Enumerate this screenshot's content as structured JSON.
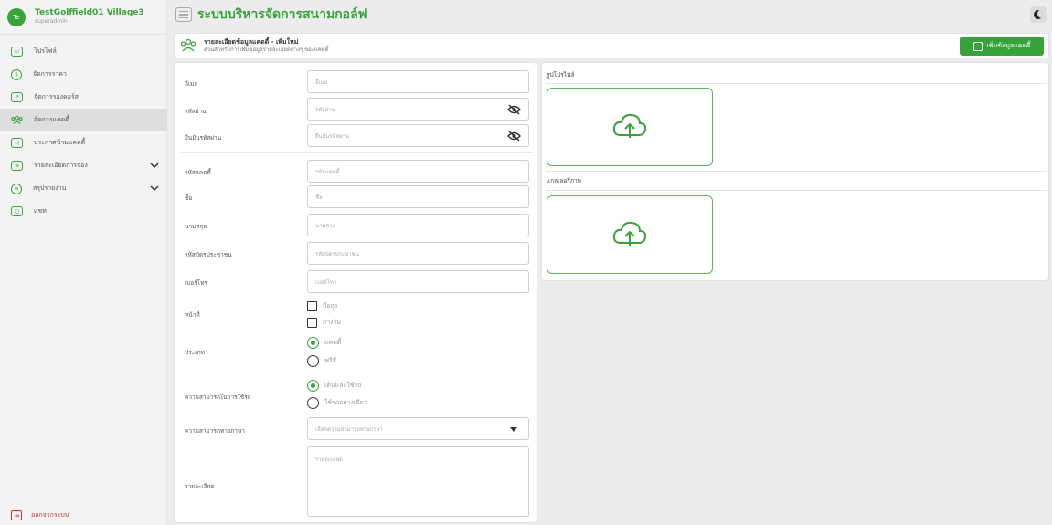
{
  "brand": {
    "avatar_text": "Te",
    "name": "TestGolffield01 Village3",
    "role": "superadmin"
  },
  "app": {
    "title": "ระบบบริหารจัดการสนามกอล์ฟ"
  },
  "sidebar": {
    "items": [
      {
        "label": "โปรไฟล์",
        "icon": "profile-card-icon",
        "active": false
      },
      {
        "label": "จัดการราคา",
        "icon": "money-coin-icon",
        "active": false
      },
      {
        "label": "จัดการรองคอร์ส",
        "icon": "chart-icon",
        "active": false
      },
      {
        "label": "จัดการแคดดี้",
        "icon": "users-group-icon",
        "active": true
      },
      {
        "label": "ประกาศข้ามแคดดี้",
        "icon": "megaphone-icon",
        "active": false
      },
      {
        "label": "รายละเอียดการจอง",
        "icon": "booking-list-icon",
        "active": false,
        "expandable": true
      },
      {
        "label": "สรุปรายงาน",
        "icon": "report-database-icon",
        "active": false,
        "expandable": true
      },
      {
        "label": "แชท",
        "icon": "chat-icon",
        "active": false
      }
    ],
    "logout_label": "ออกจากระบบ"
  },
  "header": {
    "title": "รายละเอียดข้อมูลแคดดี้ - เพิ่มใหม่",
    "subtitle": "ส่วนสำหรับการเพิ่มข้อมูลรายละเอียดต่างๆ ของแคดดี้",
    "add_button": "เพิ่มข้อมูลแคดดี้"
  },
  "form": {
    "email": {
      "label": "อีเมล",
      "placeholder": "อีเมล"
    },
    "password": {
      "label": "รหัสผ่าน",
      "placeholder": "รหัสผ่าน"
    },
    "confirm_password": {
      "label": "ยืนยันรหัสผ่าน",
      "placeholder": "ยืนยันรหัสผ่าน"
    },
    "caddy_code": {
      "label": "รหัสแคดดี้",
      "placeholder": "รหัสแคดดี้"
    },
    "first_name": {
      "label": "ชื่อ",
      "placeholder": "ชื่อ"
    },
    "last_name": {
      "label": "นามสกุล",
      "placeholder": "นามสกุล"
    },
    "id_card": {
      "label": "รหัสบัตรประชาชน",
      "placeholder": "รหัสบัตรประชาชน"
    },
    "phone": {
      "label": "เบอร์โทร",
      "placeholder": "เบอร์โทร"
    },
    "duty": {
      "label": "หน้าที่",
      "options": [
        "ถือถุง",
        "กางร่ม"
      ]
    },
    "type": {
      "label": "ประเภท",
      "options": [
        "แคดดี้",
        "ฟรีสี่"
      ],
      "selected": 0
    },
    "car_ability": {
      "label": "ความสามารถในการใช้รถ",
      "options": [
        "เดินและใช้รถ",
        "ใช้รถอย่างเดียว"
      ],
      "selected": 0
    },
    "language": {
      "label": "ความสามารถทางภาษา",
      "placeholder": "เลือกความสามารถทางภาษา"
    },
    "details": {
      "label": "รายละเอียด",
      "placeholder": "รายละเอียด"
    }
  },
  "images": {
    "profile_title": "รูปโปรไฟล์",
    "gallery_title": "แกลเลอรี่ภาพ"
  }
}
